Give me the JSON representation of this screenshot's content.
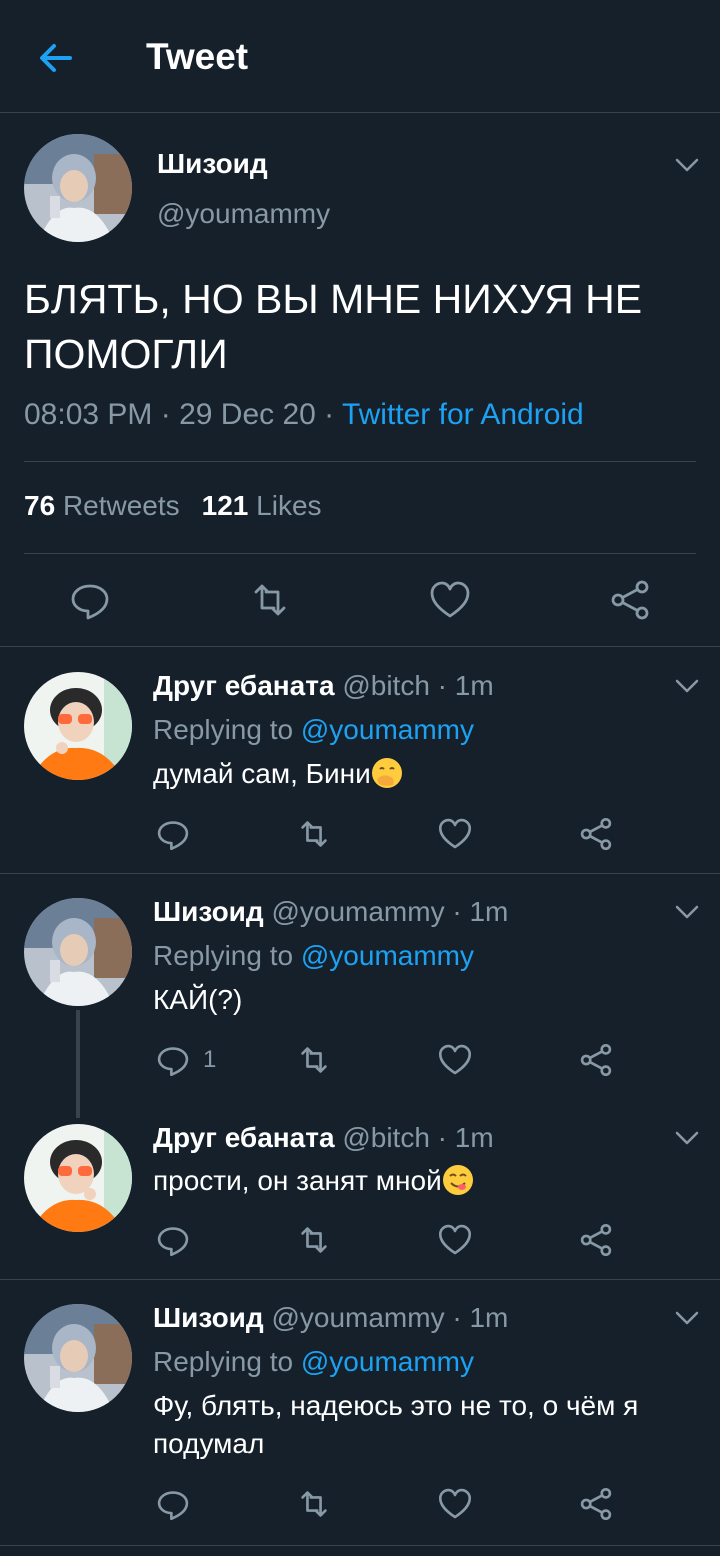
{
  "header": {
    "title": "Tweet",
    "back_icon": "arrow-left-icon",
    "accent": "#1da1f2"
  },
  "main_tweet": {
    "name": "Шизоид",
    "handle": "@youmammy",
    "text": "БЛЯТЬ, НО ВЫ МНЕ НИХУЯ НЕ ПОМОГЛИ",
    "time": "08:03 PM · 29 Dec 20 · ",
    "source": "Twitter for Android",
    "retweets_count": "76",
    "retweets_label": "Retweets",
    "likes_count": "121",
    "likes_label": "Likes"
  },
  "replies": [
    {
      "name": "Друг ебаната",
      "meta": " @bitch · 1m",
      "replying_prefix": "Replying to ",
      "replying_to": "@youmammy",
      "text": "думай сам, Бини",
      "emoji": "face-with-hand-over-mouth-emoji"
    },
    {
      "name": "Шизоид",
      "meta": " @youmammy · 1m",
      "replying_prefix": "Replying to ",
      "replying_to": "@youmammy",
      "text": "КАЙ(?)",
      "reply_count": "1"
    },
    {
      "name": "Друг ебаната",
      "meta": " @bitch · 1m",
      "text": "прости, он занят мной",
      "emoji": "face-savoring-food-emoji"
    },
    {
      "name": "Шизоид",
      "meta": " @youmammy · 1m",
      "replying_prefix": "Replying to ",
      "replying_to": "@youmammy",
      "text": "Фу, блять, надеюсь это не то, о чём я подумал"
    }
  ]
}
